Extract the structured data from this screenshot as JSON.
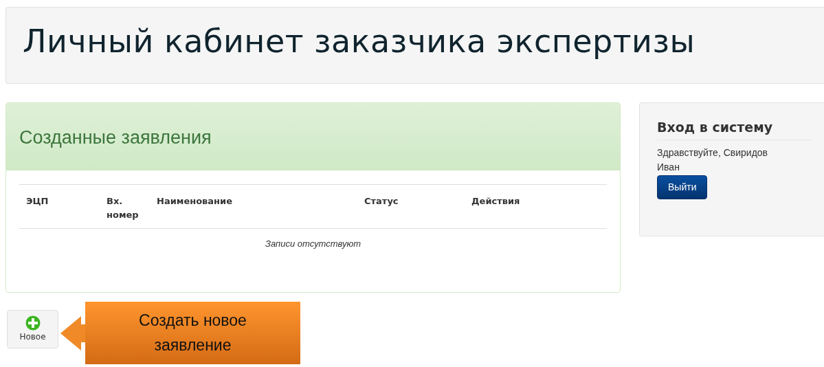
{
  "page_title": "Личный кабинет заказчика экспертизы",
  "applications_panel": {
    "title": "Созданные заявления",
    "columns": [
      "ЭЦП",
      "Вх. номер",
      "Наименование",
      "Статус",
      "Действия"
    ],
    "empty_message": "Записи отсутствуют"
  },
  "login_panel": {
    "title": "Вход в систему",
    "greeting": "Здравствуйте, Свиридов Иван",
    "logout_button": "Выйти"
  },
  "new_button": {
    "label": "Новое"
  },
  "callout": {
    "text": "Создать новое заявление"
  }
}
